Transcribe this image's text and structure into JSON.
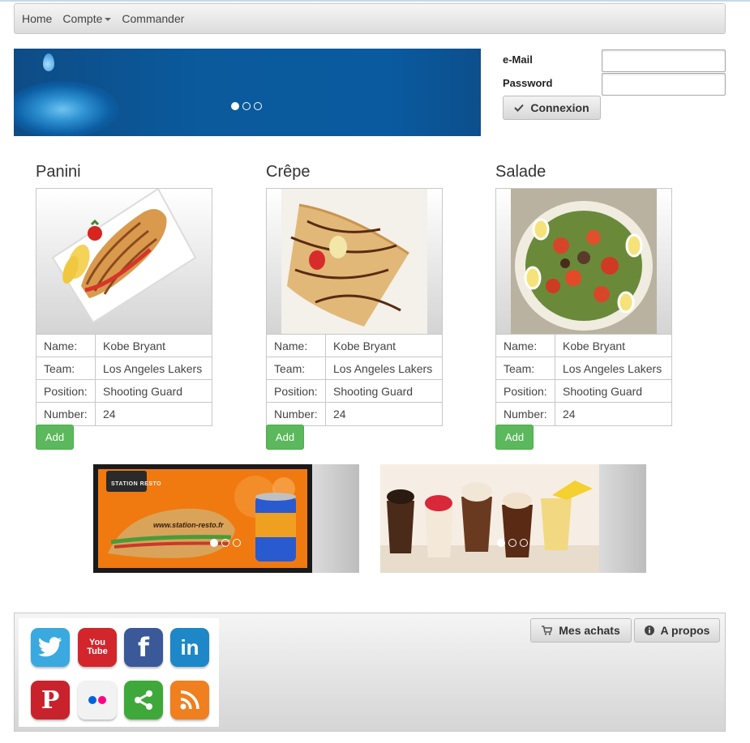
{
  "navbar": {
    "items": [
      {
        "label": "Home"
      },
      {
        "label": "Compte"
      },
      {
        "label": "Commander"
      }
    ]
  },
  "banner": {
    "slide_count": 3,
    "active_slide": 1
  },
  "login": {
    "email_label": "e-Mail",
    "email_value": "",
    "password_label": "Password",
    "password_value": "",
    "connect_label": "Connexion"
  },
  "products": [
    {
      "title": "Panini",
      "image": "panini-photo",
      "rows": [
        {
          "key": "Name:",
          "value": "Kobe Bryant"
        },
        {
          "key": "Team:",
          "value": "Los Angeles Lakers"
        },
        {
          "key": "Position:",
          "value": "Shooting Guard"
        },
        {
          "key": "Number:",
          "value": "24"
        }
      ],
      "add_label": "Add"
    },
    {
      "title": "Crêpe",
      "image": "crepe-photo",
      "rows": [
        {
          "key": "Name:",
          "value": "Kobe Bryant"
        },
        {
          "key": "Team:",
          "value": "Los Angeles Lakers"
        },
        {
          "key": "Position:",
          "value": "Shooting Guard"
        },
        {
          "key": "Number:",
          "value": "24"
        }
      ],
      "add_label": "Add"
    },
    {
      "title": "Salade",
      "image": "salad-photo",
      "rows": [
        {
          "key": "Name:",
          "value": "Kobe Bryant"
        },
        {
          "key": "Team:",
          "value": "Los Angeles Lakers"
        },
        {
          "key": "Position:",
          "value": "Shooting Guard"
        },
        {
          "key": "Number:",
          "value": "24"
        }
      ],
      "add_label": "Add"
    }
  ],
  "promos": [
    {
      "image": "station-resto-ad",
      "brand_text": "STATION RESTO",
      "url_text": "www.station-resto.fr",
      "slide_count": 3,
      "active_slide": 1
    },
    {
      "image": "desserts-photo",
      "slide_count": 3,
      "active_slide": 1
    }
  ],
  "footer": {
    "social_icons": [
      "twitter-icon",
      "youtube-icon",
      "facebook-icon",
      "linkedin-icon",
      "pinterest-icon",
      "flickr-icon",
      "share-icon",
      "rss-icon"
    ],
    "youtube_text": "You Tube",
    "purchases_label": "Mes achats",
    "about_label": "A propos"
  },
  "colors": {
    "add_button": "#5cb85c",
    "banner": "#0a5a9c",
    "twitter": "#3aa9e0",
    "youtube": "#d2262c",
    "facebook": "#3b5998",
    "linkedin": "#1d87c8",
    "pinterest": "#c8232c",
    "share": "#3fa83a",
    "rss": "#f07f20"
  }
}
